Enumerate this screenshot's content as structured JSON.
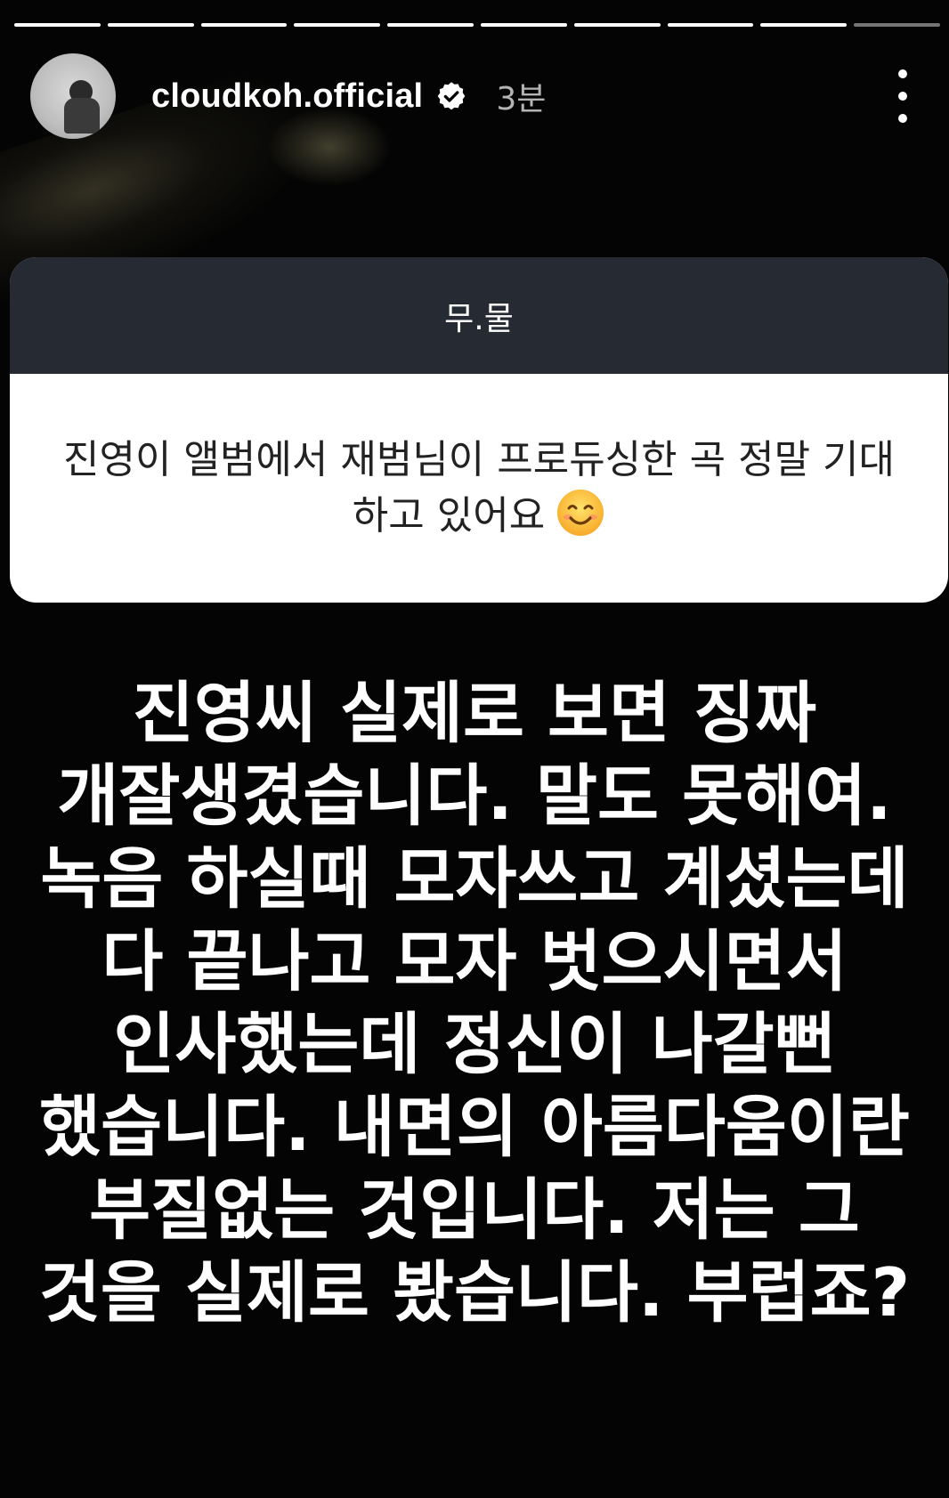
{
  "story": {
    "progress_segments": [
      {
        "state": "viewed"
      },
      {
        "state": "viewed"
      },
      {
        "state": "viewed"
      },
      {
        "state": "viewed"
      },
      {
        "state": "viewed"
      },
      {
        "state": "viewed"
      },
      {
        "state": "viewed"
      },
      {
        "state": "viewed"
      },
      {
        "state": "current"
      },
      {
        "state": "pending"
      }
    ]
  },
  "header": {
    "username": "cloudkoh.official",
    "verified_icon": "verified-badge-icon",
    "time_ago": "3분",
    "more_icon": "more-vertical-icon"
  },
  "question": {
    "title": "무.물",
    "text": "진영이 앨범에서 재범님이 프로듀싱한 곡 정말 기대하고 있어요",
    "emoji_icon": "smiling-face-emoji"
  },
  "answer": {
    "text": "진영씨 실제로 보면 징짜 개잘생겼습니다. 말도 못해여. 녹음 하실때 모자쓰고 계셨는데 다 끝나고 모자 벗으시면서 인사했는데 정신이 나갈뻔 했습니다. 내면의 아름다움이란 부질없는 것입니다. 저는 그 것을 실제로 봤습니다. 부럽죠?"
  },
  "colors": {
    "background": "#040404",
    "question_header": "#262a33",
    "question_body": "#ffffff",
    "verified_badge": "#ffffff"
  }
}
